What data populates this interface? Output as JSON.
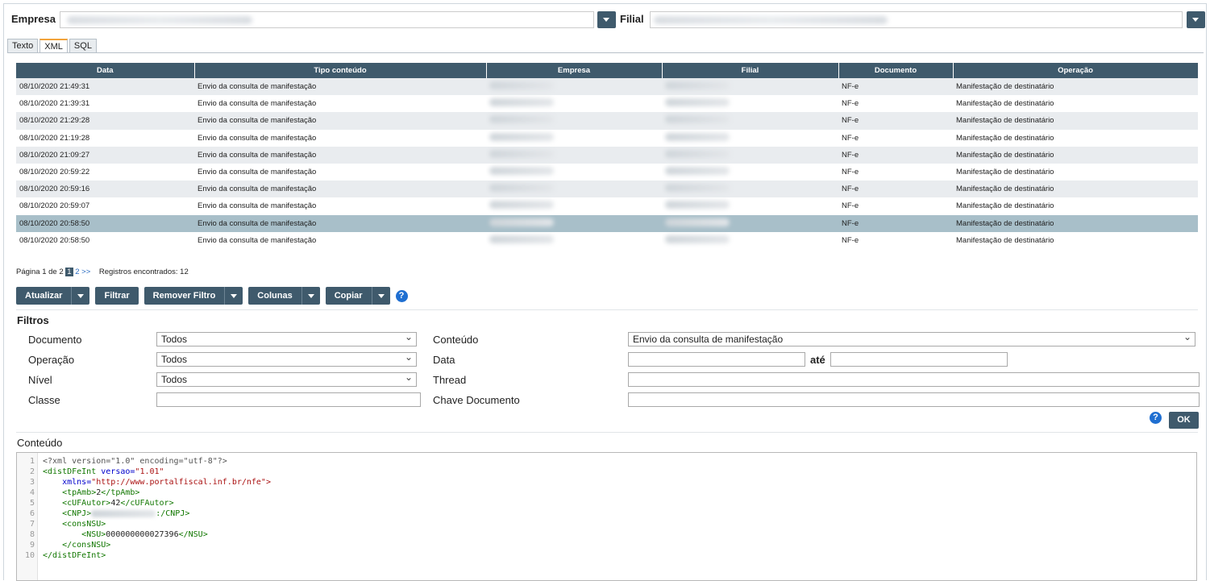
{
  "header": {
    "empresa_label": "Empresa",
    "filial_label": "Filial"
  },
  "tabs": [
    {
      "label": "Texto",
      "active": false
    },
    {
      "label": "XML",
      "active": true
    },
    {
      "label": "SQL",
      "active": false
    }
  ],
  "grid": {
    "columns": [
      "Data",
      "Tipo conteúdo",
      "Empresa",
      "Filial",
      "Documento",
      "Operação"
    ],
    "rows": [
      {
        "data": "08/10/2020 21:49:31",
        "tipo": "Envio da consulta de manifestação",
        "documento": "NF-e",
        "operacao": "Manifestação de destinatário"
      },
      {
        "data": "08/10/2020 21:39:31",
        "tipo": "Envio da consulta de manifestação",
        "documento": "NF-e",
        "operacao": "Manifestação de destinatário"
      },
      {
        "data": "08/10/2020 21:29:28",
        "tipo": "Envio da consulta de manifestação",
        "documento": "NF-e",
        "operacao": "Manifestação de destinatário"
      },
      {
        "data": "08/10/2020 21:19:28",
        "tipo": "Envio da consulta de manifestação",
        "documento": "NF-e",
        "operacao": "Manifestação de destinatário"
      },
      {
        "data": "08/10/2020 21:09:27",
        "tipo": "Envio da consulta de manifestação",
        "documento": "NF-e",
        "operacao": "Manifestação de destinatário"
      },
      {
        "data": "08/10/2020 20:59:22",
        "tipo": "Envio da consulta de manifestação",
        "documento": "NF-e",
        "operacao": "Manifestação de destinatário"
      },
      {
        "data": "08/10/2020 20:59:16",
        "tipo": "Envio da consulta de manifestação",
        "documento": "NF-e",
        "operacao": "Manifestação de destinatário"
      },
      {
        "data": "08/10/2020 20:59:07",
        "tipo": "Envio da consulta de manifestação",
        "documento": "NF-e",
        "operacao": "Manifestação de destinatário"
      },
      {
        "data": "08/10/2020 20:58:50",
        "tipo": "Envio da consulta de manifestação",
        "documento": "NF-e",
        "operacao": "Manifestação de destinatário"
      },
      {
        "data": "08/10/2020 20:58:50",
        "tipo": "Envio da consulta de manifestação",
        "documento": "NF-e",
        "operacao": "Manifestação de destinatário"
      }
    ],
    "selected_row": 8
  },
  "pager": {
    "prefix": "Página 1 de 2",
    "page1": "1",
    "page2": "2",
    "next": ">>",
    "records": "Registros encontrados: 12"
  },
  "toolbar": {
    "atualizar": "Atualizar",
    "filtrar": "Filtrar",
    "remover_filtro": "Remover Filtro",
    "colunas": "Colunas",
    "copiar": "Copiar",
    "help": "?"
  },
  "filters": {
    "title": "Filtros",
    "documento_label": "Documento",
    "documento_value": "Todos",
    "operacao_label": "Operação",
    "operacao_value": "Todos",
    "nivel_label": "Nível",
    "nivel_value": "Todos",
    "classe_label": "Classe",
    "classe_value": "",
    "conteudo_label": "Conteúdo",
    "conteudo_value": "Envio da consulta de manifestação",
    "data_label": "Data",
    "ate_label": "até",
    "thread_label": "Thread",
    "chave_label": "Chave Documento",
    "ok": "OK",
    "help": "?"
  },
  "content": {
    "label": "Conteúdo",
    "line_numbers": [
      "1",
      "2",
      "3",
      "4",
      "5",
      "6",
      "7",
      "8",
      "9",
      "10"
    ],
    "xml_decl": "<?xml version=\"1.0\" encoding=\"utf-8\"?>",
    "root_open": "<distDFeInt",
    "versao_attr": "versao=",
    "versao_val": "\"1.01\"",
    "xmlns_attr": "xmlns=",
    "xmlns_val": "\"http://www.portalfiscal.inf.br/nfe\">",
    "tpAmb_open": "<tpAmb>",
    "tpAmb_val": "2",
    "tpAmb_close": "</tpAmb>",
    "cUF_open": "<cUFAutor>",
    "cUF_val": "42",
    "cUF_close": "</cUFAutor>",
    "cnpj_open": "<CNPJ>",
    "cnpj_close": ":/CNPJ>",
    "consNSU_open": "<consNSU>",
    "nsu_open": "<NSU>",
    "nsu_val": "000000000027396",
    "nsu_close": "</NSU>",
    "consNSU_close": "</consNSU>",
    "root_close": "</distDFeInt>"
  },
  "colors": {
    "header_bg": "#3f5a6c",
    "selected_row": "#a8bfc9",
    "tab_accent": "#f2a33a",
    "help_icon": "#1f6fd1"
  }
}
